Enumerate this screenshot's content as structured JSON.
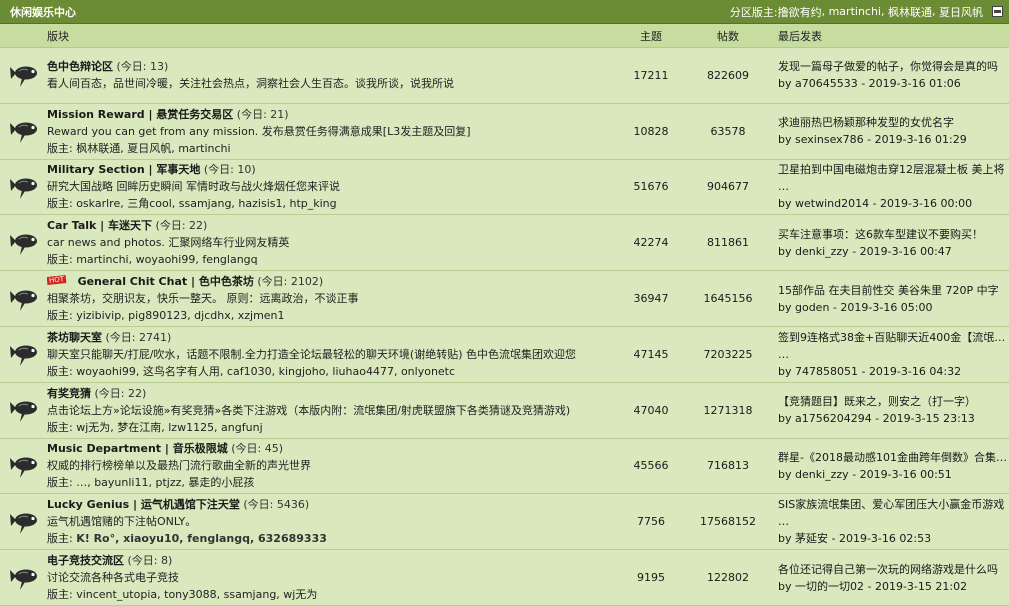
{
  "header": {
    "title": "休闲娱乐中心",
    "moderator_label": "分区版主: ",
    "moderators": [
      "撸欲有约",
      "martinchi",
      "枫林联通",
      "夏日风帆"
    ],
    "collapse_icon": "collapse-icon"
  },
  "columns": {
    "forum": "版块",
    "topics": "主题",
    "posts": "帖数",
    "last": "最后发表"
  },
  "forums": [
    {
      "name": "色中色辩论区",
      "today": "(今日: 13)",
      "desc": "看人间百态，品世间冷暖，关注社会热点，洞察社会人生百态。谈我所谈，说我所说",
      "mods": "",
      "topics": "17211",
      "posts": "822609",
      "last_title": "发现一篇母子做爱的帖子，你觉得会是真的吗",
      "last_by": "by a70645533 - 2019-3-16 01:06",
      "hot": ""
    },
    {
      "name": "Mission Reward | 悬赏任务交易区",
      "today": "(今日: 21)",
      "desc": "Reward you can get from any mission. 发布悬赏任务得满意成果[L3发主题及回复]",
      "mods": "版主: 枫林联通, 夏日风帆, martinchi",
      "topics": "10828",
      "posts": "63578",
      "last_title": "求迪丽热巴杨颖那种发型的女优名字",
      "last_by": "by sexinsex786 - 2019-3-16 01:29",
      "hot": ""
    },
    {
      "name": "Military Section | 军事天地",
      "today": "(今日: 10)",
      "desc": "研究大国战略 回眸历史瞬间 军情时政与战火烽烟任您来评说",
      "mods": "版主: oskarlre, 三角cool, ssamjang, hazisis1, htp_king",
      "topics": "51676",
      "posts": "904677",
      "last_title": "卫星拍到中国电磁炮击穿12层混凝土板 美上将",
      "last_title2": "…",
      "last_by": "by wetwind2014 - 2019-3-16 00:00",
      "hot": ""
    },
    {
      "name": "Car Talk | 车迷天下",
      "today": "(今日: 22)",
      "desc": "car news and photos. 汇聚网络车行业网友精英",
      "mods": "版主: martinchi, woyaohi99, fenglangq",
      "topics": "42274",
      "posts": "811861",
      "last_title": "买车注意事项：这6款车型建议不要购买！",
      "last_by": "by denki_zzy - 2019-3-16 00:47",
      "hot": ""
    },
    {
      "name": "General Chit Chat | 色中色茶坊",
      "today": "(今日: 2102)",
      "desc": "相聚茶坊，交朋识友，快乐一整天。 原则：远离政治，不谈正事",
      "mods": "版主: yizibivip, pig890123, djcdhx, xzjmen1",
      "topics": "36947",
      "posts": "1645156",
      "last_title": "15部作品 在夫目前性交 美谷朱里 720P 中字",
      "last_by": "by goden - 2019-3-16 05:00",
      "hot": "HOT"
    },
    {
      "name": "茶坊聊天室",
      "today": "(今日: 2741)",
      "desc": "聊天室只能聊天/打屁/吹水，话题不限制.全力打造全论坛最轻松的聊天环境(谢绝转贴) 色中色流氓集团欢迎您",
      "mods": "版主: woyaohi99, 这鸟名字有人用, caf1030, kingjoho, liuhao4477, onlyonetc",
      "topics": "47145",
      "posts": "7203225",
      "last_title": "签到9连格式38金+百贴聊天近400金【流氓集团",
      "last_title2": "…",
      "last_by": "by 747858051 - 2019-3-16 04:32",
      "hot": ""
    },
    {
      "name": "有奖竞猜",
      "today": "(今日: 22)",
      "desc": "点击论坛上方»论坛设施»有奖竞猜»各类下注游戏（本版内附：流氓集团/射虎联盟旗下各类猜谜及竞猜游戏)",
      "mods": "版主: wj无为, 梦在江南, lzw1125, angfunj",
      "topics": "47040",
      "posts": "1271318",
      "last_title": "【竞猜题目】既来之，则安之（打一字）",
      "last_by": "by a1756204294 - 2019-3-15 23:13",
      "hot": ""
    },
    {
      "name": "Music Department | 音乐极限城",
      "today": "(今日: 45)",
      "desc": "权威的排行榜榜单以及最热门流行歌曲全新的声光世界",
      "mods": "版主: …, bayunli11, ptjzz, 暴走的小屁孩",
      "topics": "45566",
      "posts": "716813",
      "last_title": "群星-《2018最动感101金曲跨年倒数》合集[3 …",
      "last_by": "by denki_zzy - 2019-3-16 00:51",
      "hot": ""
    },
    {
      "name": "Lucky Genius | 运气机遇馆下注天堂",
      "today": "(今日: 5436)",
      "desc": "运气机遇馆赌的下注帖ONLY。",
      "mods_label": "版主: ",
      "mods_bold": "K! Ro°, xiaoyu10, fenglangq, 632689333",
      "topics": "7756",
      "posts": "17568152",
      "last_title": "SIS家族流氓集团、爱心军团压大小赢金币游戏",
      "last_title2": "…",
      "last_by": "by 茅延安 - 2019-3-16 02:53",
      "hot": ""
    },
    {
      "name": "电子竞技交流区",
      "today": "(今日: 8)",
      "desc": "讨论交流各种各式电子竞技",
      "mods": "版主: vincent_utopia, tony3088, ssamjang, wj无为",
      "topics": "9195",
      "posts": "122802",
      "last_title": "各位还记得自己第一次玩的网络游戏是什么吗",
      "last_by": "by 一切的一切02 - 2019-3-15 21:02",
      "hot": ""
    }
  ],
  "forum_icon": "fish-icon"
}
